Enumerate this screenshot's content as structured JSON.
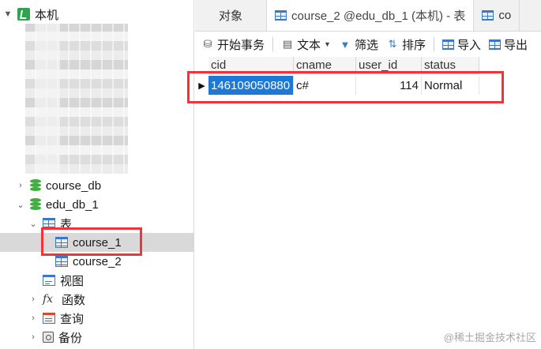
{
  "tree": {
    "root_label": "本机",
    "items": [
      {
        "label": "course_db",
        "type": "database",
        "expanded": false
      },
      {
        "label": "edu_db_1",
        "type": "database",
        "expanded": true
      },
      {
        "label": "表",
        "type": "table-folder",
        "expanded": true
      },
      {
        "label": "course_1",
        "type": "table",
        "selected": true
      },
      {
        "label": "course_2",
        "type": "table"
      },
      {
        "label": "视图",
        "type": "view-folder"
      },
      {
        "label": "函数",
        "type": "function-folder"
      },
      {
        "label": "查询",
        "type": "query-folder"
      },
      {
        "label": "备份",
        "type": "backup-folder"
      }
    ]
  },
  "tabs": [
    {
      "label": "对象"
    },
    {
      "label": "course_2 @edu_db_1 (本机) - 表",
      "active": true
    },
    {
      "label": "co"
    }
  ],
  "toolbar": {
    "begin_transaction": "开始事务",
    "text": "文本",
    "filter": "筛选",
    "sort": "排序",
    "import": "导入",
    "export": "导出"
  },
  "grid": {
    "columns": [
      "cid",
      "cname",
      "user_id",
      "status"
    ],
    "rows": [
      [
        "146109050880",
        "c#",
        "114",
        "Normal"
      ]
    ]
  },
  "watermark": "@稀土掘金技术社区",
  "colors": {
    "selection": "#1e78d6",
    "highlight_box": "#f0343c",
    "db_icon": "#3fae3f",
    "table_icon": "#3c78c8"
  }
}
